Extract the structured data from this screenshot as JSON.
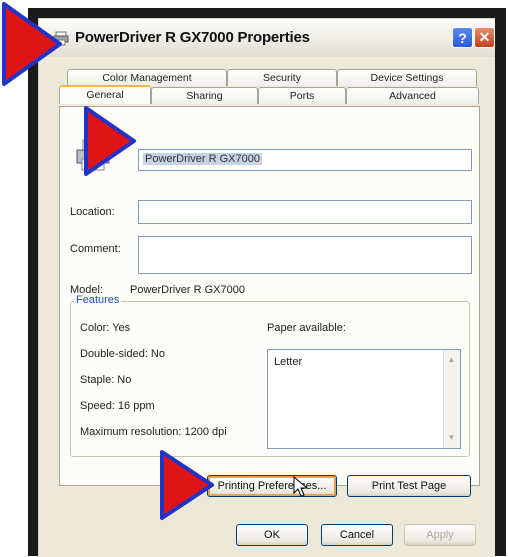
{
  "window": {
    "title": "PowerDriver R GX7000 Properties",
    "help_label": "?",
    "close_label": "✕"
  },
  "tabs": {
    "back_row": [
      "Color Management",
      "Security",
      "Device Settings"
    ],
    "front_row": [
      "General",
      "Sharing",
      "Ports",
      "Advanced"
    ],
    "active": "General"
  },
  "general": {
    "printer_name": "PowerDriver R GX7000",
    "location_label": "Location:",
    "location_value": "",
    "comment_label": "Comment:",
    "comment_value": "",
    "model_label": "Model:",
    "model_value": "PowerDriver R GX7000"
  },
  "features": {
    "title": "Features",
    "color": "Color: Yes",
    "double_sided": "Double-sided: No",
    "staple": "Staple: No",
    "speed": "Speed: 16 ppm",
    "max_resolution": "Maximum resolution: 1200 dpi",
    "paper_label": "Paper available:",
    "paper_items": [
      "Letter"
    ]
  },
  "buttons": {
    "printing_preferences": "Printing Preferences...",
    "print_test_page": "Print Test Page",
    "ok": "OK",
    "cancel": "Cancel",
    "apply": "Apply"
  },
  "colors": {
    "pointer_red": "#e01414",
    "pointer_outline": "#2233c8",
    "focus_orange": "#e8a34c"
  },
  "icons": {
    "pointer": "red-triangle-pointer-icon",
    "printer": "printer-icon",
    "cursor": "mouse-cursor-icon"
  }
}
